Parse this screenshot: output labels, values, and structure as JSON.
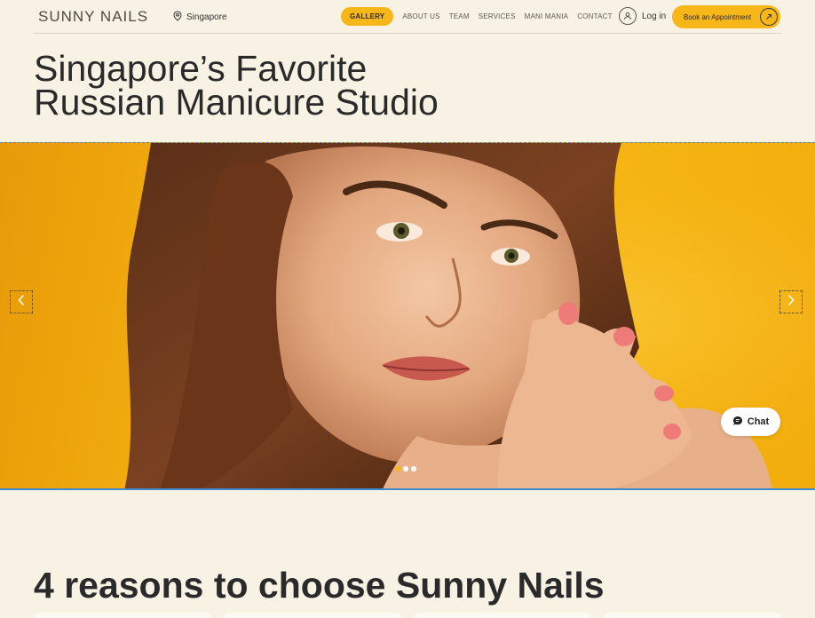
{
  "header": {
    "brand": "SUNNY NAILS",
    "location": "Singapore",
    "location_icon": "location-pin-icon",
    "nav": [
      {
        "label": "GALLERY",
        "active": true
      },
      {
        "label": "ABOUT US",
        "active": false
      },
      {
        "label": "TEAM",
        "active": false
      },
      {
        "label": "SERVICES",
        "active": false
      },
      {
        "label": "MANI MANIA",
        "active": false
      },
      {
        "label": "CONTACT",
        "active": false
      }
    ],
    "login_label": "Log in",
    "login_icon": "user-icon",
    "book_label": "Book an Appointment",
    "book_icon": "arrow-up-right-icon"
  },
  "hero": {
    "title_line1": "Singapore’s Favorite",
    "title_line2": "Russian Manicure Studio"
  },
  "slider": {
    "prev_icon": "chevron-left-icon",
    "next_icon": "chevron-right-icon",
    "slide_count": 3,
    "active_slide": 1
  },
  "chat": {
    "label": "Chat",
    "icon": "chat-bubble-icon"
  },
  "reasons": {
    "title": "4 reasons to choose Sunny Nails"
  },
  "colors": {
    "accent": "#f7b719",
    "background": "#f7f2e3",
    "text": "#2a2a2a"
  }
}
